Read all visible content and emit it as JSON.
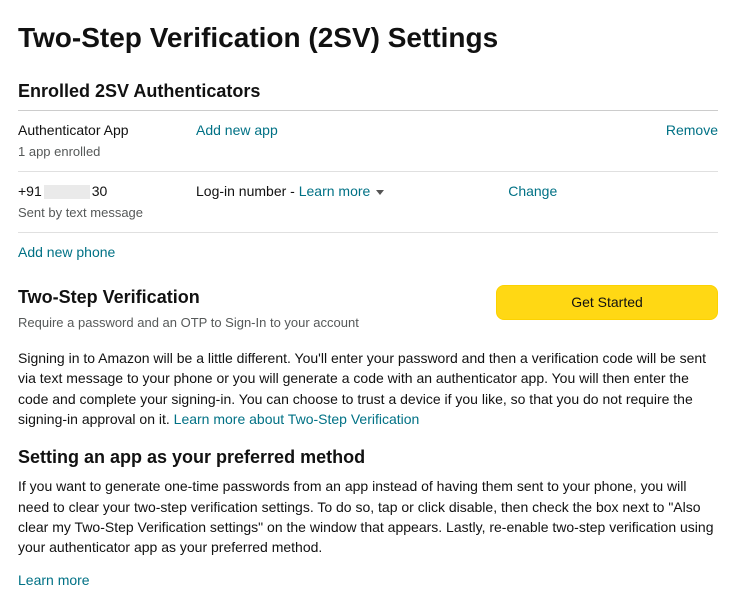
{
  "page_title": "Two-Step Verification (2SV) Settings",
  "enrolled_section": {
    "heading": "Enrolled 2SV Authenticators",
    "auth_app": {
      "label": "Authenticator App",
      "sub": "1 app enrolled",
      "add_link": "Add new app",
      "remove_link": "Remove"
    },
    "phone": {
      "prefix": "+91",
      "suffix": "30",
      "delivery": "Sent by text message",
      "login_label": "Log-in number - ",
      "learn_more": "Learn more",
      "change": "Change"
    },
    "add_phone": "Add new phone"
  },
  "tsv": {
    "heading": "Two-Step Verification",
    "subhead": "Require a password and an OTP to Sign-In to your account",
    "button": "Get Started",
    "body": "Signing in to Amazon will be a little different. You'll enter your password and then a verification code will be sent via text message to your phone or you will generate a code with an authenticator app. You will then enter the code and complete your signing-in. You can choose to trust a device if you like, so that you do not require the signing-in approval on it. ",
    "body_link": "Learn more about Two-Step Verification"
  },
  "preferred": {
    "heading": "Setting an app as your preferred method",
    "body": "If you want to generate one-time passwords from an app instead of having them sent to your phone, you will need to clear your two-step verification settings. To do so, tap or click disable, then check the box next to \"Also clear my Two-Step Verification settings\" on the window that appears. Lastly, re-enable two-step verification using your authenticator app as your preferred method.",
    "learn_more": "Learn more"
  }
}
